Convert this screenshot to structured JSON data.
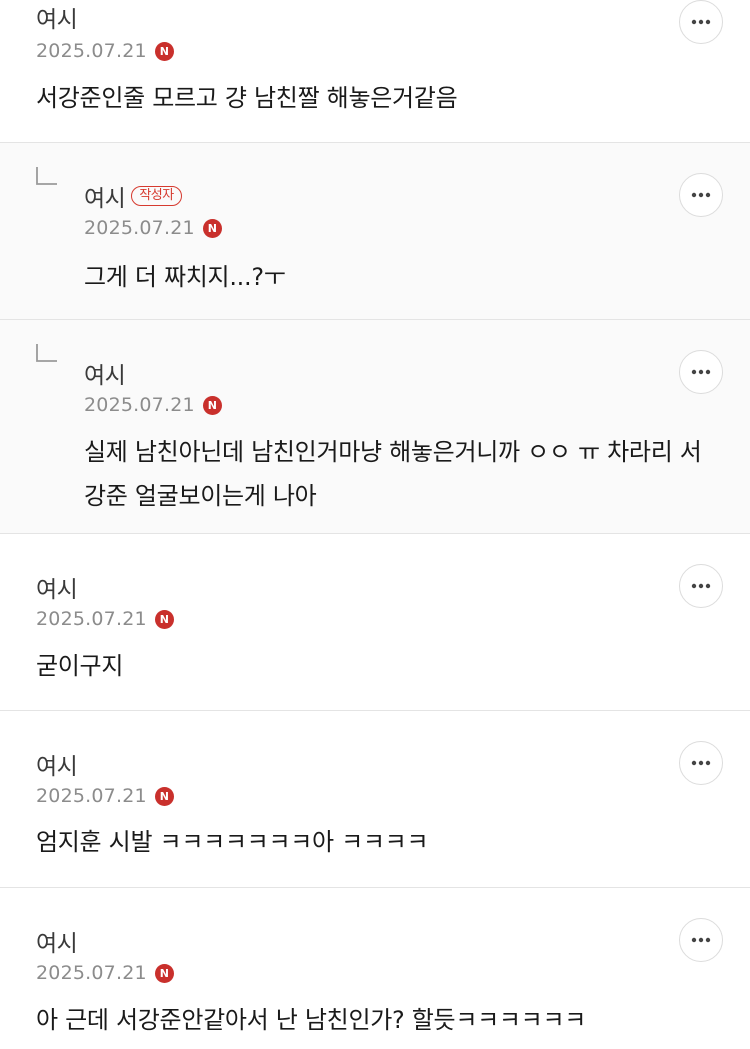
{
  "comments": [
    {
      "author": "여시",
      "date": "2025.07.21",
      "text": "서강준인줄 모르고 걍 남친짤 해놓은거같음",
      "is_reply": false
    },
    {
      "author": "여시",
      "badge": "작성자",
      "date": "2025.07.21",
      "text": "그게 더 짜치지...?ㅜ",
      "is_reply": true
    },
    {
      "author": "여시",
      "date": "2025.07.21",
      "text": "실제 남친아닌데 남친인거마냥 해놓은거니까 ㅇㅇ ㅠ 차라리 서강준 얼굴보이는게 나아",
      "is_reply": true
    },
    {
      "author": "여시",
      "date": "2025.07.21",
      "text": "굳이구지",
      "is_reply": false
    },
    {
      "author": "여시",
      "date": "2025.07.21",
      "text": "엄지훈 시발 ㅋㅋㅋㅋㅋㅋㅋ아 ㅋㅋㅋㅋ",
      "is_reply": false
    },
    {
      "author": "여시",
      "date": "2025.07.21",
      "text": "아 근데 서강준안같아서 난 남친인가? 할듯ㅋㅋㅋㅋㅋㅋ",
      "is_reply": false
    }
  ],
  "icons": {
    "more": "more-dots-icon",
    "reply": "reply-arrow-icon",
    "naver_badge": "N"
  },
  "colors": {
    "accent_red": "#c9302c",
    "badge_red": "#d63a2f",
    "date_gray": "#8c8c8c",
    "divider": "#e4e4e4"
  }
}
